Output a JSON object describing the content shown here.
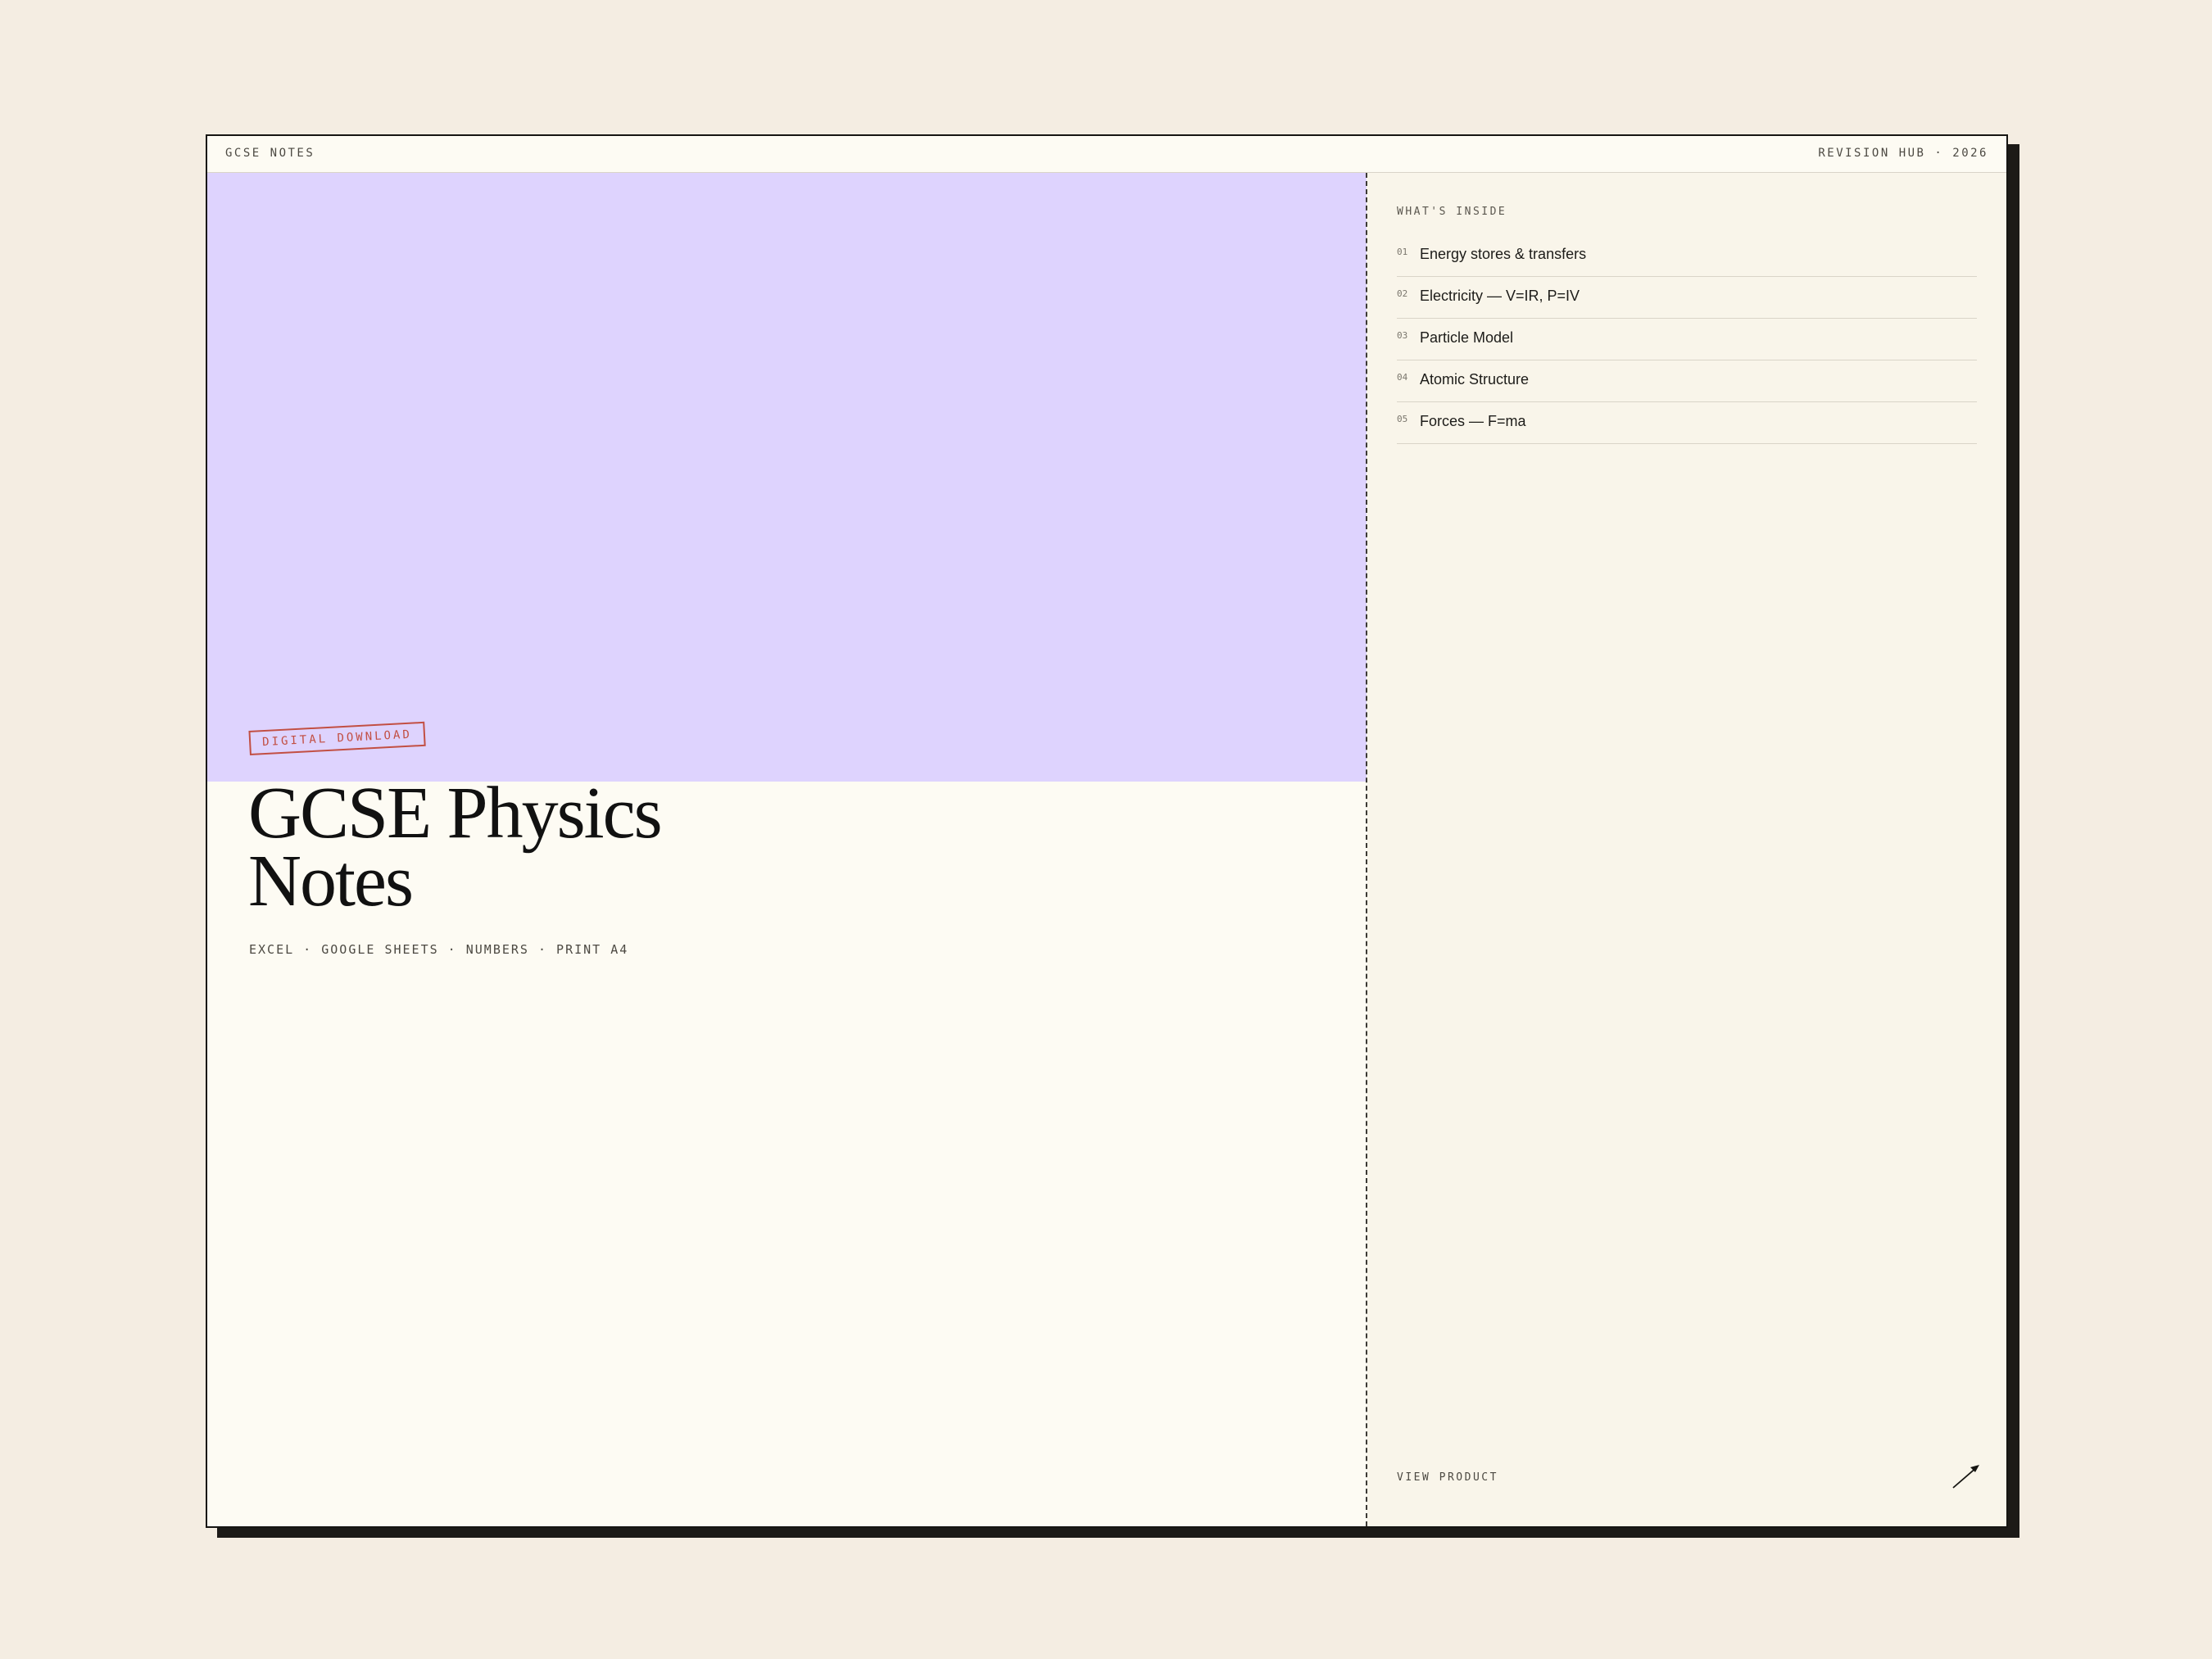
{
  "header": {
    "brand": "GCSE NOTES",
    "meta": "REVISION HUB · 2026"
  },
  "product": {
    "badge": "DIGITAL DOWNLOAD",
    "title_line1": "GCSE Physics",
    "title_line2": "Notes",
    "formats": "EXCEL · GOOGLE SHEETS · NUMBERS · PRINT A4",
    "hero_color": "#ded3fe",
    "badge_color": "#c24f43"
  },
  "contents": {
    "heading": "WHAT'S INSIDE",
    "items": [
      {
        "num": "01",
        "label": "Energy stores & transfers"
      },
      {
        "num": "02",
        "label": "Electricity — V=IR, P=IV"
      },
      {
        "num": "03",
        "label": "Particle Model"
      },
      {
        "num": "04",
        "label": "Atomic Structure"
      },
      {
        "num": "05",
        "label": "Forces — F=ma"
      }
    ]
  },
  "cta": {
    "label": "VIEW PRODUCT",
    "icon": "arrow-up-right-icon"
  }
}
